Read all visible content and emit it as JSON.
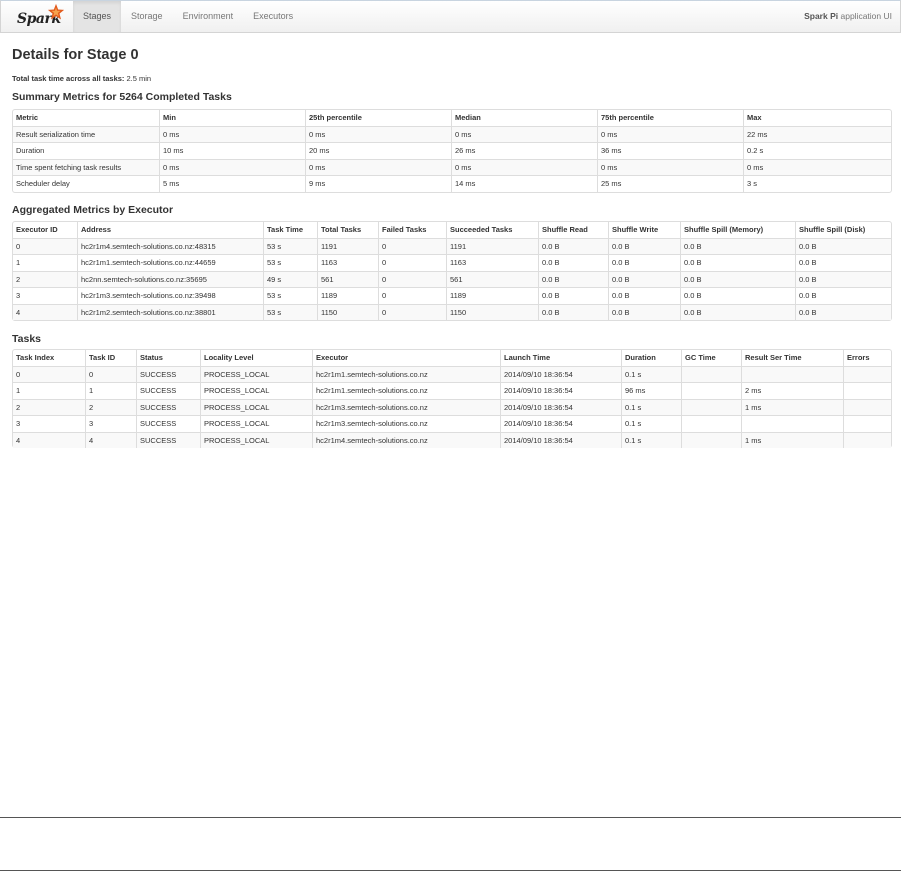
{
  "nav": {
    "brand": "Spark",
    "tabs": [
      "Stages",
      "Storage",
      "Environment",
      "Executors"
    ],
    "active_tab": "Stages",
    "app_name_bold": "Spark Pi",
    "app_name_rest": " application UI"
  },
  "page": {
    "title": "Details for Stage 0",
    "total_label": "Total task time across all tasks:",
    "total_value": " 2.5 min"
  },
  "summary": {
    "title": "Summary Metrics for 5264 Completed Tasks",
    "headers": [
      "Metric",
      "Min",
      "25th percentile",
      "Median",
      "75th percentile",
      "Max"
    ],
    "rows": [
      [
        "Result serialization time",
        "0 ms",
        "0 ms",
        "0 ms",
        "0 ms",
        "22 ms"
      ],
      [
        "Duration",
        "10 ms",
        "20 ms",
        "26 ms",
        "36 ms",
        "0.2 s"
      ],
      [
        "Time spent fetching task results",
        "0 ms",
        "0 ms",
        "0 ms",
        "0 ms",
        "0 ms"
      ],
      [
        "Scheduler delay",
        "5 ms",
        "9 ms",
        "14 ms",
        "25 ms",
        "3 s"
      ]
    ]
  },
  "aggregated": {
    "title": "Aggregated Metrics by Executor",
    "headers": [
      "Executor ID",
      "Address",
      "Task Time",
      "Total Tasks",
      "Failed Tasks",
      "Succeeded Tasks",
      "Shuffle Read",
      "Shuffle Write",
      "Shuffle Spill (Memory)",
      "Shuffle Spill (Disk)"
    ],
    "rows": [
      [
        "0",
        "hc2r1m4.semtech-solutions.co.nz:48315",
        "53 s",
        "1191",
        "0",
        "1191",
        "0.0 B",
        "0.0 B",
        "0.0 B",
        "0.0 B"
      ],
      [
        "1",
        "hc2r1m1.semtech-solutions.co.nz:44659",
        "53 s",
        "1163",
        "0",
        "1163",
        "0.0 B",
        "0.0 B",
        "0.0 B",
        "0.0 B"
      ],
      [
        "2",
        "hc2nn.semtech-solutions.co.nz:35695",
        "49 s",
        "561",
        "0",
        "561",
        "0.0 B",
        "0.0 B",
        "0.0 B",
        "0.0 B"
      ],
      [
        "3",
        "hc2r1m3.semtech-solutions.co.nz:39498",
        "53 s",
        "1189",
        "0",
        "1189",
        "0.0 B",
        "0.0 B",
        "0.0 B",
        "0.0 B"
      ],
      [
        "4",
        "hc2r1m2.semtech-solutions.co.nz:38801",
        "53 s",
        "1150",
        "0",
        "1150",
        "0.0 B",
        "0.0 B",
        "0.0 B",
        "0.0 B"
      ]
    ]
  },
  "tasks": {
    "title": "Tasks",
    "headers": [
      "Task Index",
      "Task ID",
      "Status",
      "Locality Level",
      "Executor",
      "Launch Time",
      "Duration",
      "GC Time",
      "Result Ser Time",
      "Errors"
    ],
    "rows": [
      [
        "0",
        "0",
        "SUCCESS",
        "PROCESS_LOCAL",
        "hc2r1m1.semtech-solutions.co.nz",
        "2014/09/10 18:36:54",
        "0.1 s",
        "",
        "",
        ""
      ],
      [
        "1",
        "1",
        "SUCCESS",
        "PROCESS_LOCAL",
        "hc2r1m1.semtech-solutions.co.nz",
        "2014/09/10 18:36:54",
        "96 ms",
        "",
        "2 ms",
        ""
      ],
      [
        "2",
        "2",
        "SUCCESS",
        "PROCESS_LOCAL",
        "hc2r1m3.semtech-solutions.co.nz",
        "2014/09/10 18:36:54",
        "0.1 s",
        "",
        "1 ms",
        ""
      ],
      [
        "3",
        "3",
        "SUCCESS",
        "PROCESS_LOCAL",
        "hc2r1m3.semtech-solutions.co.nz",
        "2014/09/10 18:36:54",
        "0.1 s",
        "",
        "",
        ""
      ],
      [
        "4",
        "4",
        "SUCCESS",
        "PROCESS_LOCAL",
        "hc2r1m4.semtech-solutions.co.nz",
        "2014/09/10 18:36:54",
        "0.1 s",
        "",
        "1 ms",
        ""
      ]
    ]
  }
}
